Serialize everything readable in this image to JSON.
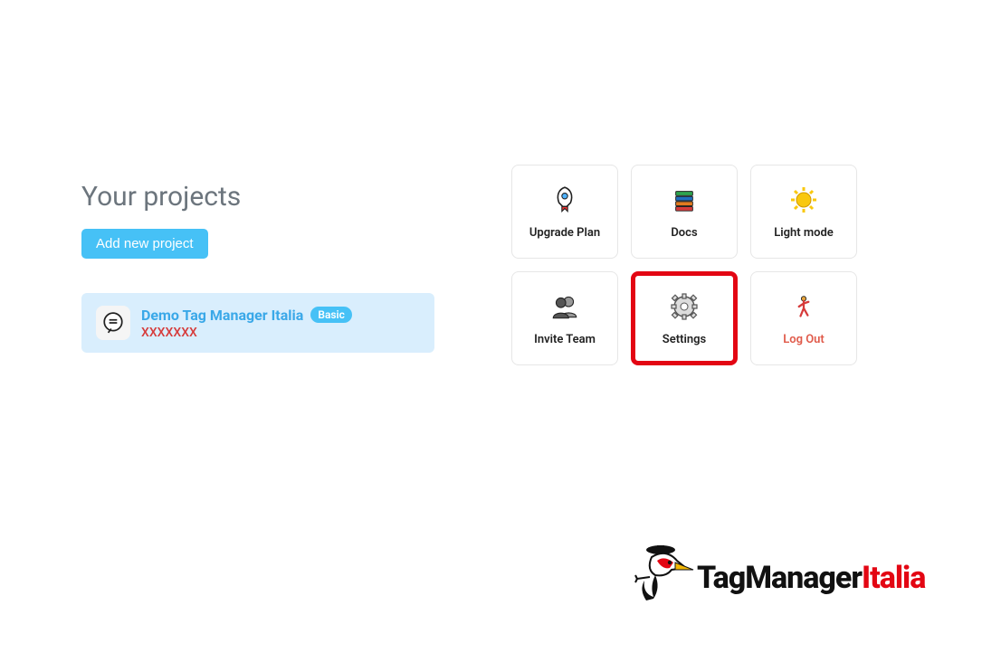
{
  "heading": "Your projects",
  "add_button_label": "Add new project",
  "project": {
    "title": "Demo Tag Manager Italia",
    "badge": "Basic",
    "subtitle": "XXXXXXX"
  },
  "tiles": {
    "upgrade": "Upgrade Plan",
    "docs": "Docs",
    "lightmode": "Light mode",
    "invite": "Invite Team",
    "settings": "Settings",
    "logout": "Log Out"
  },
  "brand": {
    "part1": "TagManager",
    "part2": "Italia"
  }
}
